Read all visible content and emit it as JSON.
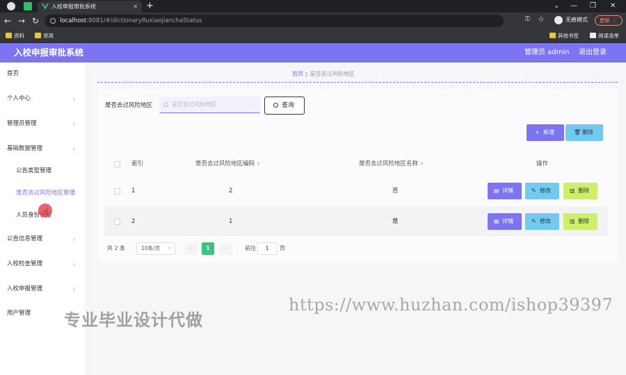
{
  "browser": {
    "tab_title": "入校申报审批系统",
    "url_host": "localhost",
    "url_path": ":8081/#/dictionaryRuxiaojianchaStatus",
    "incognito_label": "无痕模式",
    "update_label": "更新",
    "bookmarks_left": [
      "资料",
      "常用"
    ],
    "bookmarks_right": [
      "其他书签",
      "阅读清单"
    ]
  },
  "header": {
    "title": "入校申报审批系统",
    "admin": "管理员 admin",
    "logout": "退出登录"
  },
  "sidebar": {
    "items": [
      {
        "label": "首页",
        "sub": false,
        "active": false,
        "chevron": false
      },
      {
        "label": "个人中心",
        "sub": false,
        "active": false,
        "chevron": true
      },
      {
        "label": "管理员管理",
        "sub": false,
        "active": false,
        "chevron": true
      },
      {
        "label": "基础数据管理",
        "sub": false,
        "active": false,
        "chevron": true
      },
      {
        "label": "公告类型管理",
        "sub": true,
        "active": false,
        "chevron": false
      },
      {
        "label": "是否去过风险地区管理",
        "sub": true,
        "active": true,
        "chevron": false
      },
      {
        "label": "人员身份管理",
        "sub": true,
        "active": false,
        "chevron": false
      },
      {
        "label": "公告信息管理",
        "sub": false,
        "active": false,
        "chevron": true
      },
      {
        "label": "入校检查管理",
        "sub": false,
        "active": false,
        "chevron": true
      },
      {
        "label": "入校申报管理",
        "sub": false,
        "active": false,
        "chevron": true
      },
      {
        "label": "用户管理",
        "sub": false,
        "active": false,
        "chevron": true
      }
    ]
  },
  "breadcrumb": {
    "home": "首页",
    "current": "是否去过风险地区"
  },
  "search": {
    "label": "是否去过风险地区",
    "placeholder": "是否去过风险地区",
    "button": "查询"
  },
  "actions": {
    "add": "新增",
    "delete": "删除"
  },
  "table": {
    "headers": [
      "索引",
      "是否去过风险地区编码",
      "是否去过风险地区名称",
      "操作"
    ],
    "rows": [
      {
        "index": "1",
        "code": "2",
        "name": "否"
      },
      {
        "index": "2",
        "code": "1",
        "name": "是"
      }
    ],
    "ops": {
      "detail": "详情",
      "edit": "修改",
      "delete": "删除"
    }
  },
  "pagination": {
    "total": "共 2 条",
    "page_size": "10条/页",
    "current_page": "1",
    "goto_label": "前往",
    "goto_value": "1",
    "page_unit": "页"
  },
  "watermark": {
    "left": "专业毕业设计代做",
    "right": "https://www.huzhan.com/ishop39397"
  },
  "colors": {
    "accent": "#7c74f2",
    "secondary": "#72c9f2",
    "lime": "#cdf06a",
    "page_active": "#3ac47d"
  }
}
